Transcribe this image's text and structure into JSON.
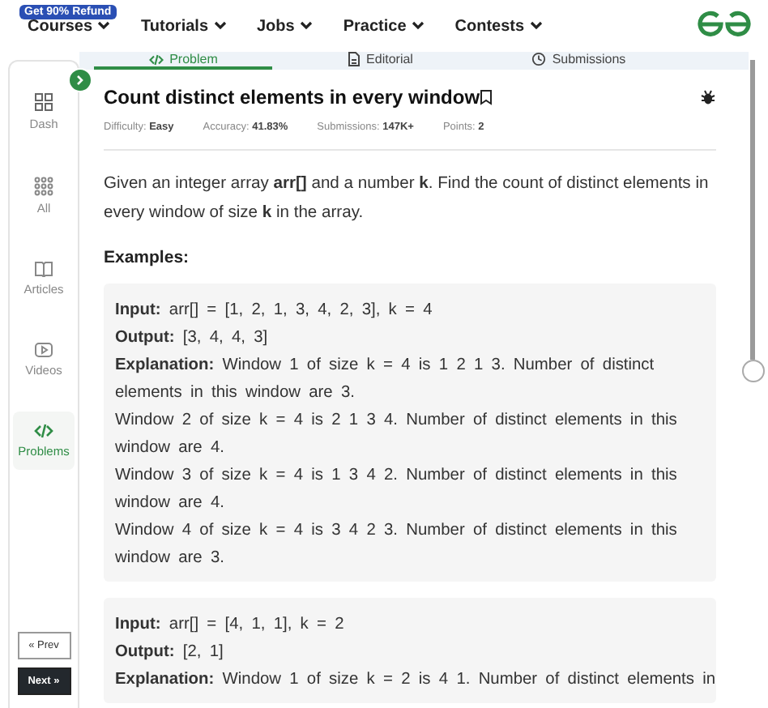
{
  "promo_badge": "Get 90% Refund",
  "nav": [
    {
      "label": "Courses"
    },
    {
      "label": "Tutorials"
    },
    {
      "label": "Jobs"
    },
    {
      "label": "Practice"
    },
    {
      "label": "Contests"
    }
  ],
  "sidebar": [
    {
      "label": "Dash",
      "kind": "dash",
      "selected": false
    },
    {
      "label": "All",
      "kind": "all",
      "selected": false
    },
    {
      "label": "Articles",
      "kind": "articles",
      "selected": false
    },
    {
      "label": "Videos",
      "kind": "videos",
      "selected": false
    },
    {
      "label": "Problems",
      "kind": "problems",
      "selected": true
    }
  ],
  "pager": [
    {
      "label": "« Prev",
      "kind": "prev"
    },
    {
      "label": "Next »",
      "kind": "next"
    }
  ],
  "tabs": [
    {
      "label": "Problem",
      "kind": "code",
      "selected": true
    },
    {
      "label": "Editorial",
      "kind": "doc",
      "selected": false
    },
    {
      "label": "Submissions",
      "kind": "clock",
      "selected": false
    }
  ],
  "title": "Count distinct elements in every window",
  "meta": [
    {
      "label": "Difficulty:",
      "value": "Easy"
    },
    {
      "label": "Accuracy:",
      "value": "41.83%"
    },
    {
      "label": "Submissions:",
      "value": "147K+"
    },
    {
      "label": "Points:",
      "value": "2"
    }
  ],
  "description": "Given an integer array **arr[]** and a number **k**. Find the count of distinct elements in every window of size **k** in the array.",
  "examples_heading": "Examples:",
  "examples": [
    {
      "lines": [
        "**Input:** arr[] = [1, 2, 1, 3, 4, 2, 3], k = 4",
        "**Output:**  [3, 4, 4, 3]",
        "**Explanation:** Window 1 of size k = 4 is 1 2 1 3. Number of distinct elements in this window are 3.",
        "Window 2 of size k = 4 is 2 1 3 4. Number of distinct elements in this window are 4.",
        "Window 3 of size k = 4 is 1 3 4 2. Number of distinct elements in this window are 4.",
        "Window 4 of size k = 4 is 3 4 2 3. Number of distinct elements in this window are 3."
      ]
    },
    {
      "lines": [
        "**Input:** arr[] = [4, 1, 1], k = 2",
        "**Output:** [2, 1]",
        "**Explanation:** Window 1 of size k = 2 is 4 1. Number of distinct elements in"
      ]
    }
  ]
}
